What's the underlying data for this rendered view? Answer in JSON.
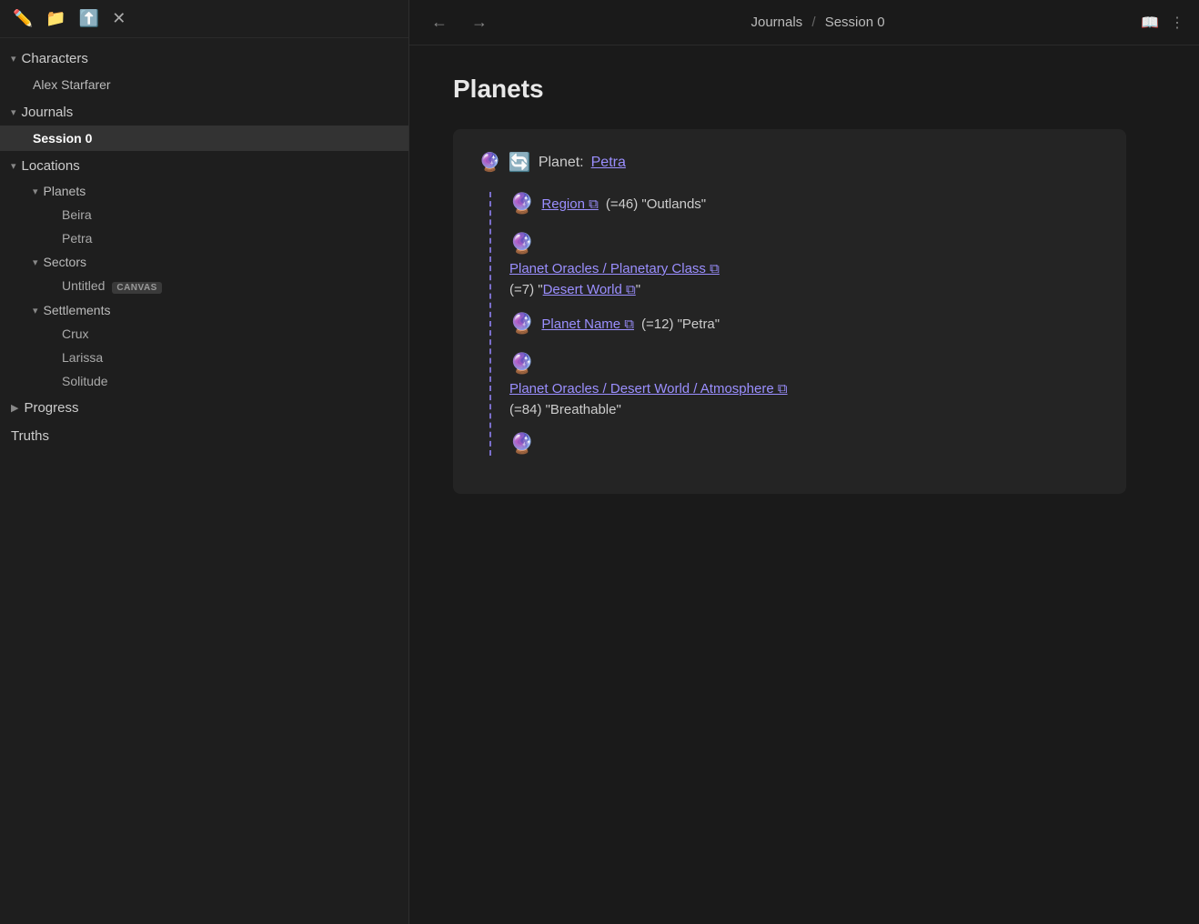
{
  "sidebar": {
    "toolbar_icons": [
      "edit-icon",
      "folder-plus-icon",
      "sort-icon",
      "close-icon"
    ],
    "groups": [
      {
        "label": "Characters",
        "expanded": true,
        "chevron": "▾",
        "children": [
          {
            "label": "Alex Starfarer",
            "active": false,
            "indent": 1
          }
        ]
      },
      {
        "label": "Journals",
        "expanded": true,
        "chevron": "▾",
        "children": [
          {
            "label": "Session 0",
            "active": true,
            "indent": 1
          }
        ]
      },
      {
        "label": "Locations",
        "expanded": true,
        "chevron": "▾",
        "subgroups": [
          {
            "label": "Planets",
            "expanded": true,
            "chevron": "▾",
            "children": [
              {
                "label": "Beira"
              },
              {
                "label": "Petra"
              }
            ]
          },
          {
            "label": "Sectors",
            "expanded": true,
            "chevron": "▾",
            "children": [
              {
                "label": "Untitled",
                "badge": "CANVAS"
              }
            ]
          },
          {
            "label": "Settlements",
            "expanded": true,
            "chevron": "▾",
            "children": [
              {
                "label": "Crux"
              },
              {
                "label": "Larissa"
              },
              {
                "label": "Solitude"
              }
            ]
          }
        ]
      },
      {
        "label": "Progress",
        "expanded": false,
        "chevron": "▶",
        "children": []
      },
      {
        "label": "Truths",
        "expanded": false,
        "chevron": null,
        "children": []
      }
    ]
  },
  "header": {
    "back_label": "←",
    "forward_label": "→",
    "breadcrumb_part1": "Journals",
    "breadcrumb_sep": "/",
    "breadcrumb_part2": "Session 0",
    "book_icon": "📖",
    "more_icon": "⋮"
  },
  "main": {
    "page_title": "Planets",
    "card": {
      "planet_emoji": "🔮",
      "refresh_emoji": "🔄",
      "planet_prefix": "Planet:",
      "planet_link": "Petra",
      "entries": [
        {
          "type": "inline",
          "globe_emoji": "🔮",
          "link_text": "Region",
          "external_icon": "⧉",
          "result": "(=46) \"Outlands\""
        },
        {
          "type": "block",
          "globe_emoji": "🔮",
          "link_line1": "Planet Oracles / Planetary Class",
          "external_icon": "⧉",
          "link_line2": "Desert World",
          "link_line2_external": "⧉",
          "result": "(=7)"
        },
        {
          "type": "inline",
          "globe_emoji": "🔮",
          "link_text": "Planet Name",
          "external_icon": "⧉",
          "result": "(=12) \"Petra\""
        },
        {
          "type": "block",
          "globe_emoji": "🔮",
          "link_line1": "Planet Oracles / Desert World /",
          "link_line2": "Atmosphere",
          "external_icon": "⧉",
          "result": "(=84) \"Breathable\""
        },
        {
          "type": "globe_only",
          "globe_emoji": "🔮"
        }
      ]
    }
  }
}
